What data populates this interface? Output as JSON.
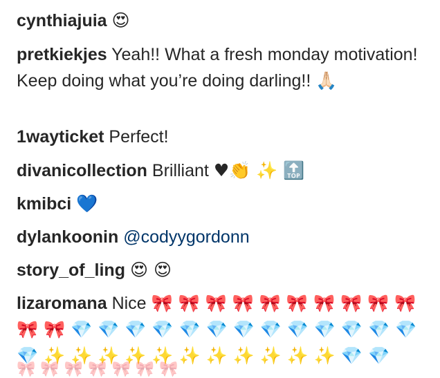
{
  "comments": [
    {
      "username": "cynthiajuia",
      "text": "",
      "emoji": "😍"
    },
    {
      "username": "pretkiekjes",
      "text": "Yeah!! What a fresh monday motivation! Keep doing what you’re doing darling!!",
      "emoji": "🙏🏻"
    },
    {
      "username": "1wayticket",
      "text": "Perfect!",
      "emoji": ""
    },
    {
      "username": "divanicollection",
      "text": "Brilliant",
      "emoji": "♥👏 ✨ 🔝"
    },
    {
      "username": "kmibci",
      "text": "",
      "emoji": "💙"
    },
    {
      "username": "dylankoonin",
      "text": "",
      "mention": "@codyygordonn"
    },
    {
      "username": "story_of_ling",
      "text": "",
      "emoji": "😍 😍"
    },
    {
      "username": "lizaromana",
      "text": "Nice",
      "emoji": "🎀 🎀 🎀 🎀 🎀 🎀 🎀 🎀 🎀 🎀 🎀 🎀 💎 💎 💎 💎 💎 💎 💎 💎 💎 💎 💎 💎 💎 💎 ✨ ✨ ✨ ✨ ✨ ✨ ✨ ✨ ✨ ✨ ✨ 💎 💎"
    }
  ],
  "partial_row": "🎀 🎀 🎀 🎀 🎀 🎀 🎀"
}
